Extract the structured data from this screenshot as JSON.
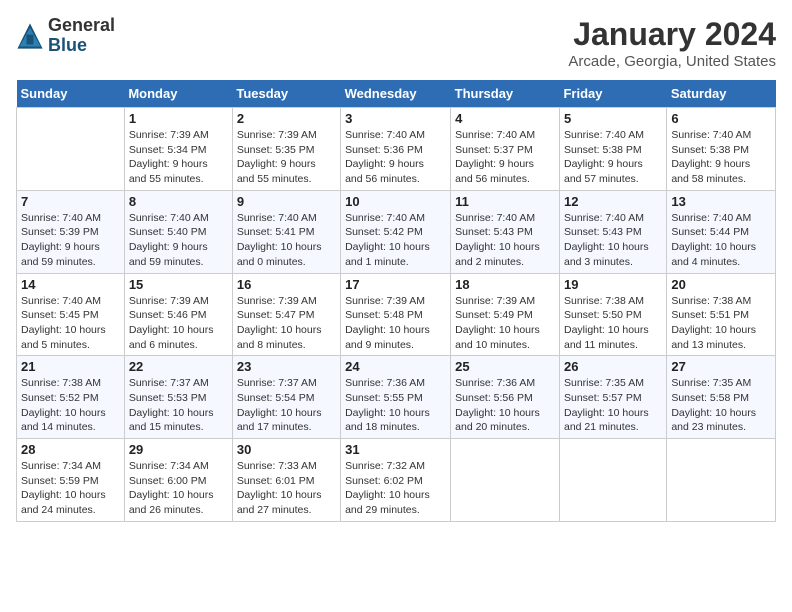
{
  "logo": {
    "general": "General",
    "blue": "Blue"
  },
  "title": "January 2024",
  "location": "Arcade, Georgia, United States",
  "days_header": [
    "Sunday",
    "Monday",
    "Tuesday",
    "Wednesday",
    "Thursday",
    "Friday",
    "Saturday"
  ],
  "weeks": [
    [
      {
        "day": "",
        "info": ""
      },
      {
        "day": "1",
        "info": "Sunrise: 7:39 AM\nSunset: 5:34 PM\nDaylight: 9 hours\nand 55 minutes."
      },
      {
        "day": "2",
        "info": "Sunrise: 7:39 AM\nSunset: 5:35 PM\nDaylight: 9 hours\nand 55 minutes."
      },
      {
        "day": "3",
        "info": "Sunrise: 7:40 AM\nSunset: 5:36 PM\nDaylight: 9 hours\nand 56 minutes."
      },
      {
        "day": "4",
        "info": "Sunrise: 7:40 AM\nSunset: 5:37 PM\nDaylight: 9 hours\nand 56 minutes."
      },
      {
        "day": "5",
        "info": "Sunrise: 7:40 AM\nSunset: 5:38 PM\nDaylight: 9 hours\nand 57 minutes."
      },
      {
        "day": "6",
        "info": "Sunrise: 7:40 AM\nSunset: 5:38 PM\nDaylight: 9 hours\nand 58 minutes."
      }
    ],
    [
      {
        "day": "7",
        "info": "Sunrise: 7:40 AM\nSunset: 5:39 PM\nDaylight: 9 hours\nand 59 minutes."
      },
      {
        "day": "8",
        "info": "Sunrise: 7:40 AM\nSunset: 5:40 PM\nDaylight: 9 hours\nand 59 minutes."
      },
      {
        "day": "9",
        "info": "Sunrise: 7:40 AM\nSunset: 5:41 PM\nDaylight: 10 hours\nand 0 minutes."
      },
      {
        "day": "10",
        "info": "Sunrise: 7:40 AM\nSunset: 5:42 PM\nDaylight: 10 hours\nand 1 minute."
      },
      {
        "day": "11",
        "info": "Sunrise: 7:40 AM\nSunset: 5:43 PM\nDaylight: 10 hours\nand 2 minutes."
      },
      {
        "day": "12",
        "info": "Sunrise: 7:40 AM\nSunset: 5:43 PM\nDaylight: 10 hours\nand 3 minutes."
      },
      {
        "day": "13",
        "info": "Sunrise: 7:40 AM\nSunset: 5:44 PM\nDaylight: 10 hours\nand 4 minutes."
      }
    ],
    [
      {
        "day": "14",
        "info": "Sunrise: 7:40 AM\nSunset: 5:45 PM\nDaylight: 10 hours\nand 5 minutes."
      },
      {
        "day": "15",
        "info": "Sunrise: 7:39 AM\nSunset: 5:46 PM\nDaylight: 10 hours\nand 6 minutes."
      },
      {
        "day": "16",
        "info": "Sunrise: 7:39 AM\nSunset: 5:47 PM\nDaylight: 10 hours\nand 8 minutes."
      },
      {
        "day": "17",
        "info": "Sunrise: 7:39 AM\nSunset: 5:48 PM\nDaylight: 10 hours\nand 9 minutes."
      },
      {
        "day": "18",
        "info": "Sunrise: 7:39 AM\nSunset: 5:49 PM\nDaylight: 10 hours\nand 10 minutes."
      },
      {
        "day": "19",
        "info": "Sunrise: 7:38 AM\nSunset: 5:50 PM\nDaylight: 10 hours\nand 11 minutes."
      },
      {
        "day": "20",
        "info": "Sunrise: 7:38 AM\nSunset: 5:51 PM\nDaylight: 10 hours\nand 13 minutes."
      }
    ],
    [
      {
        "day": "21",
        "info": "Sunrise: 7:38 AM\nSunset: 5:52 PM\nDaylight: 10 hours\nand 14 minutes."
      },
      {
        "day": "22",
        "info": "Sunrise: 7:37 AM\nSunset: 5:53 PM\nDaylight: 10 hours\nand 15 minutes."
      },
      {
        "day": "23",
        "info": "Sunrise: 7:37 AM\nSunset: 5:54 PM\nDaylight: 10 hours\nand 17 minutes."
      },
      {
        "day": "24",
        "info": "Sunrise: 7:36 AM\nSunset: 5:55 PM\nDaylight: 10 hours\nand 18 minutes."
      },
      {
        "day": "25",
        "info": "Sunrise: 7:36 AM\nSunset: 5:56 PM\nDaylight: 10 hours\nand 20 minutes."
      },
      {
        "day": "26",
        "info": "Sunrise: 7:35 AM\nSunset: 5:57 PM\nDaylight: 10 hours\nand 21 minutes."
      },
      {
        "day": "27",
        "info": "Sunrise: 7:35 AM\nSunset: 5:58 PM\nDaylight: 10 hours\nand 23 minutes."
      }
    ],
    [
      {
        "day": "28",
        "info": "Sunrise: 7:34 AM\nSunset: 5:59 PM\nDaylight: 10 hours\nand 24 minutes."
      },
      {
        "day": "29",
        "info": "Sunrise: 7:34 AM\nSunset: 6:00 PM\nDaylight: 10 hours\nand 26 minutes."
      },
      {
        "day": "30",
        "info": "Sunrise: 7:33 AM\nSunset: 6:01 PM\nDaylight: 10 hours\nand 27 minutes."
      },
      {
        "day": "31",
        "info": "Sunrise: 7:32 AM\nSunset: 6:02 PM\nDaylight: 10 hours\nand 29 minutes."
      },
      {
        "day": "",
        "info": ""
      },
      {
        "day": "",
        "info": ""
      },
      {
        "day": "",
        "info": ""
      }
    ]
  ]
}
